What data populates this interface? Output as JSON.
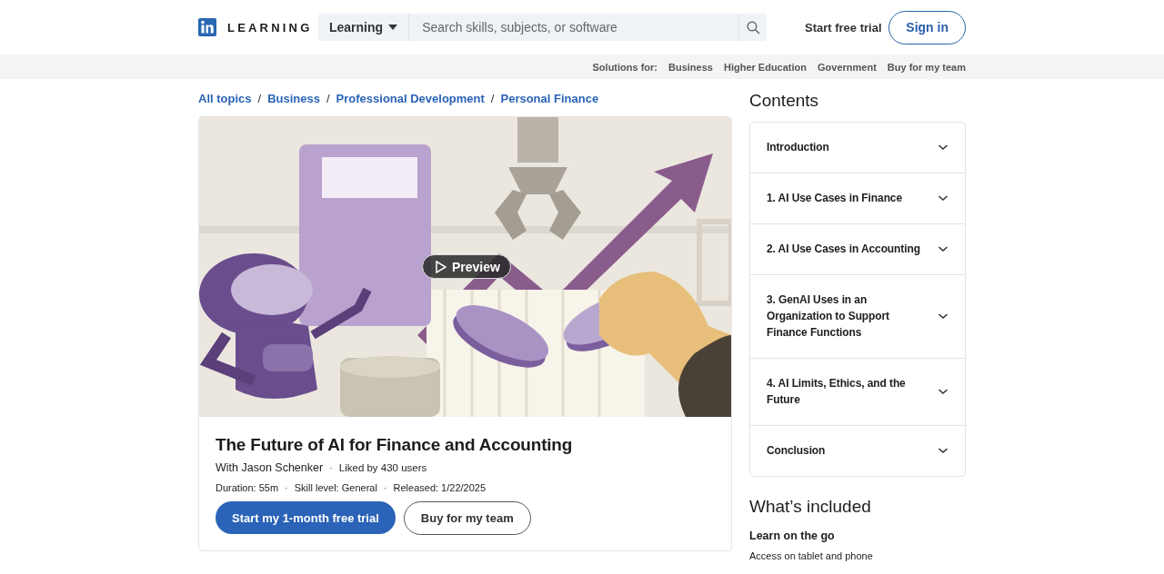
{
  "header": {
    "logo_text": "LEARNING",
    "search": {
      "scope": "Learning",
      "placeholder": "Search skills, subjects, or software"
    },
    "start_trial": "Start free trial",
    "sign_in": "Sign in"
  },
  "solutions_bar": {
    "label": "Solutions for:",
    "links": [
      "Business",
      "Higher Education",
      "Government",
      "Buy for my team"
    ]
  },
  "breadcrumb": [
    {
      "label": "All topics"
    },
    {
      "separator": "/",
      "label": "Business"
    },
    {
      "separator": "/",
      "label": "Professional Development"
    },
    {
      "separator": "/",
      "label": "Personal Finance"
    }
  ],
  "course": {
    "preview_label": "Preview",
    "title": "The Future of AI for Finance and Accounting",
    "instructor": "With Jason Schenker",
    "likes_separator": "·",
    "likes": "Liked by 430 users",
    "meta": [
      {
        "text": "Duration: 55m"
      },
      {
        "separator": "·",
        "text": "Skill level: General"
      },
      {
        "separator": "·",
        "text": "Released: 1/22/2025"
      }
    ],
    "primary_button": "Start my 1-month free trial",
    "secondary_button": "Buy for my team"
  },
  "contents": {
    "title": "Contents",
    "sections": [
      {
        "label": "Introduction",
        "expanded": false
      },
      {
        "label": "1. AI Use Cases in Finance",
        "expanded": false
      },
      {
        "label": "2. AI Use Cases in Accounting",
        "expanded": false
      },
      {
        "label": "3. GenAI Uses in an Organization to Support Finance Functions",
        "expanded": false
      },
      {
        "label": "4. AI Limits, Ethics, and the Future",
        "expanded": false
      },
      {
        "label": "Conclusion",
        "expanded": false
      }
    ]
  },
  "included": {
    "title": "What’s included",
    "items": [
      {
        "heading": "Learn on the go",
        "text": "Access on tablet and phone"
      }
    ]
  }
}
